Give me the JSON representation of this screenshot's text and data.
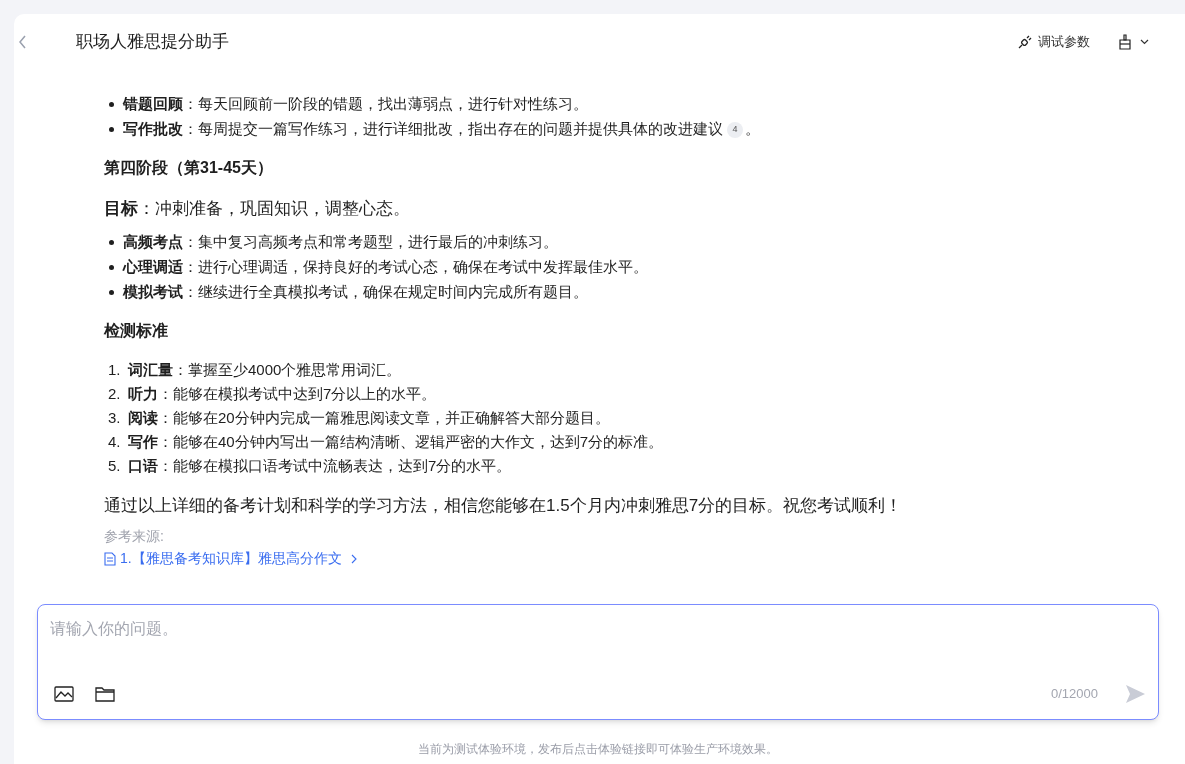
{
  "header": {
    "title": "职场人雅思提分助手",
    "debug_button": "调试参数"
  },
  "content": [
    {
      "kind": "bullets",
      "items": [
        {
          "text": "**错题回顾**：每天回顾前一阶段的错题，找出薄弱点，进行针对性练习。"
        },
        {
          "text": "**写作批改**：每周提交一篇写作练习，进行详细批改，指出存在的问题并提供具体的改进建议",
          "citation": "4",
          "tail": "。"
        }
      ]
    },
    {
      "kind": "heading",
      "text": "第四阶段（第31-45天）"
    },
    {
      "kind": "lead",
      "text": "**目标**：冲刺准备，巩固知识，调整心态。"
    },
    {
      "kind": "bullets",
      "items": [
        {
          "text": "**高频考点**：集中复习高频考点和常考题型，进行最后的冲刺练习。"
        },
        {
          "text": "**心理调适**：进行心理调适，保持良好的考试心态，确保在考试中发挥最佳水平。"
        },
        {
          "text": "**模拟考试**：继续进行全真模拟考试，确保在规定时间内完成所有题目。"
        }
      ]
    },
    {
      "kind": "heading",
      "text": "检测标准"
    },
    {
      "kind": "numbered",
      "items": [
        {
          "number": "1.",
          "text": "**词汇量**：掌握至少4000个雅思常用词汇。"
        },
        {
          "number": "2.",
          "text": "**听力**：能够在模拟考试中达到7分以上的水平。"
        },
        {
          "number": "3.",
          "text": "**阅读**：能够在20分钟内完成一篇雅思阅读文章，并正确解答大部分题目。"
        },
        {
          "number": "4.",
          "text": "**写作**：能够在40分钟内写出一篇结构清晰、逻辑严密的大作文，达到7分的标准。"
        },
        {
          "number": "5.",
          "text": "**口语**：能够在模拟口语考试中流畅表达，达到7分的水平。"
        }
      ]
    },
    {
      "kind": "lead",
      "text": "通过以上详细的备考计划和科学的学习方法，相信您能够在1.5个月内冲刺雅思7分的目标。祝您考试顺利！"
    }
  ],
  "sources": {
    "label": "参考来源:",
    "links": [
      "1.【雅思备考知识库】雅思高分作文"
    ]
  },
  "input": {
    "placeholder": "请输入你的问题。",
    "counter": "0/12000"
  },
  "footer": "当前为测试体验环境，发布后点击体验链接即可体验生产环境效果。"
}
